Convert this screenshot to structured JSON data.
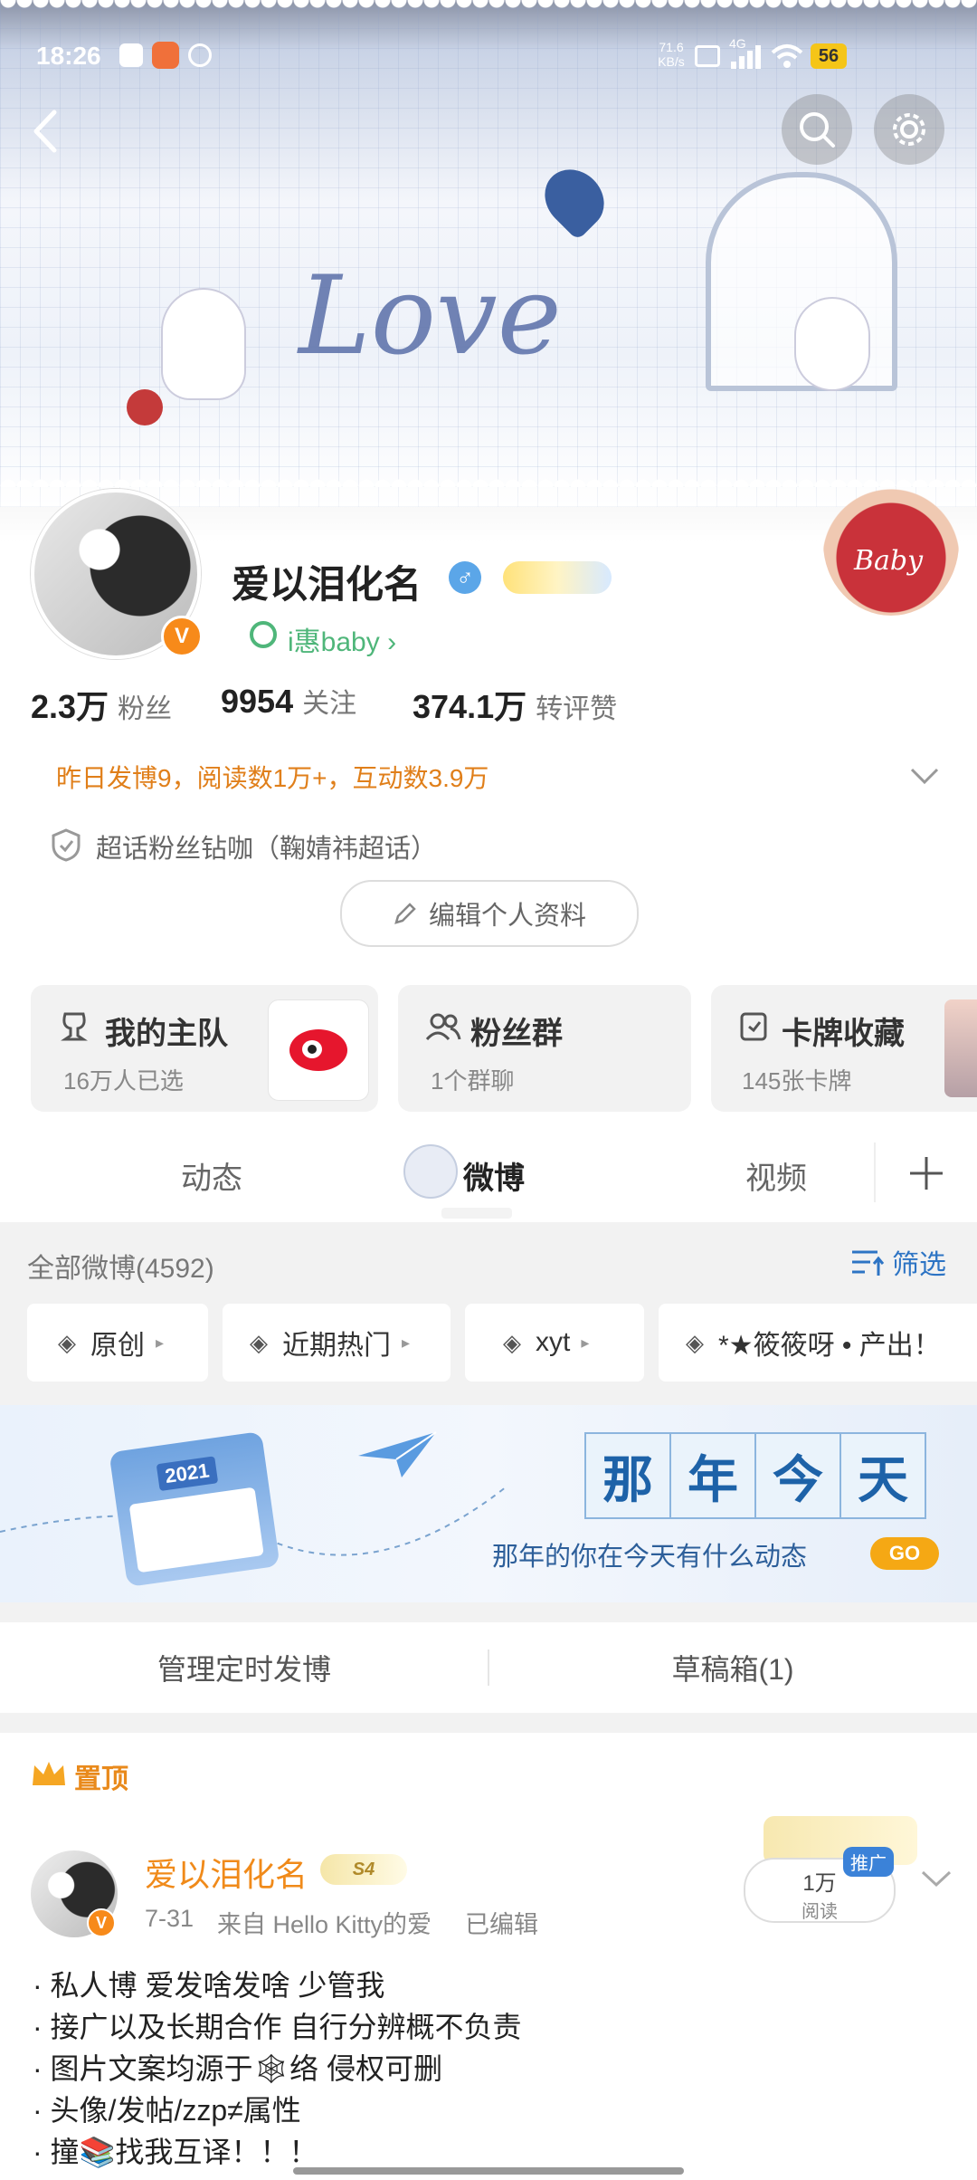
{
  "status_bar": {
    "time": "18:26",
    "network_speed": "71.6 KB/s",
    "signal_label": "4G",
    "battery": "56"
  },
  "banner": {
    "decoration_text": "Love",
    "sticker_text": "Baby"
  },
  "profile": {
    "name": "爱以泪化名",
    "gender_symbol": "♂",
    "subtitle": "i惠baby",
    "verified_mark": "V"
  },
  "stats": [
    {
      "value": "2.3万",
      "label": "粉丝"
    },
    {
      "value": "9954",
      "label": "关注"
    },
    {
      "value": "374.1万",
      "label": "转评赞"
    }
  ],
  "activity_summary": "昨日发博9，阅读数1万+，互动数3.9万",
  "super_topic": "超话粉丝钻咖（鞠婧祎超话）",
  "edit_profile_label": "编辑个人资料",
  "cards": [
    {
      "title": "我的主队",
      "subtitle": "16万人已选"
    },
    {
      "title": "粉丝群",
      "subtitle": "1个群聊"
    },
    {
      "title": "卡牌收藏",
      "subtitle": "145张卡牌"
    }
  ],
  "tabs": [
    {
      "label": "动态",
      "active": false
    },
    {
      "label": "微博",
      "active": true
    },
    {
      "label": "视频",
      "active": false
    }
  ],
  "filter": {
    "all_label": "全部微博(4592)",
    "filter_button": "筛选",
    "chips": [
      "原创",
      "近期热门",
      "xyt",
      "*★筱筱呀 • 产出！"
    ]
  },
  "memory_banner": {
    "chars": [
      "那",
      "年",
      "今",
      "天"
    ],
    "subtitle": "那年的你在今天有什么动态",
    "go_label": "GO",
    "calendar_year": "2021"
  },
  "actions": {
    "scheduled": "管理定时发博",
    "drafts": "草稿箱(1)"
  },
  "pinned": {
    "label": "置顶"
  },
  "post": {
    "author": "爱以泪化名",
    "date": "7-31",
    "source": "来自 Hello Kitty的爱",
    "edited": "已编辑",
    "promo_tag": "推广",
    "read_count": "1万",
    "read_label": "阅读",
    "badge_text": "S4",
    "lines": [
      "· 私人博 爱发啥发啥 少管我",
      "· 接广以及长期合作 自行分辨概不负责",
      "· 图片文案均源于🕸络 侵权可删",
      "· 头像/发帖/zzp≠属性",
      "· 撞📚找我互译！！！"
    ]
  },
  "colors": {
    "brand_orange": "#f78a1a",
    "link_blue": "#2d74c4",
    "page_bg": "#f2f2f2"
  }
}
